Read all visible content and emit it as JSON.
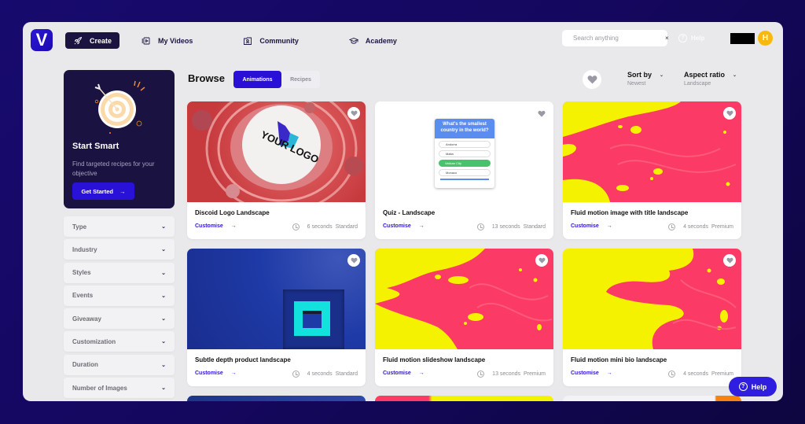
{
  "app": {
    "logo_letter": "V",
    "brand_color": "#2a0fd6"
  },
  "nav": {
    "items": [
      {
        "label": "Create",
        "icon": "rocket-icon",
        "active": true
      },
      {
        "label": "My Videos",
        "icon": "video-library-icon",
        "active": false
      },
      {
        "label": "Community",
        "icon": "community-icon",
        "active": false
      },
      {
        "label": "Academy",
        "icon": "graduation-cap-icon",
        "active": false
      }
    ],
    "search": {
      "placeholder": "Search anything",
      "value": "",
      "clear": "×"
    },
    "help_label": "Help",
    "help_glyph": "?",
    "avatar_initial": "H"
  },
  "promo": {
    "title": "Start Smart",
    "description": "Find targeted recipes for your objective",
    "cta_label": "Get Started",
    "cta_arrow": "→"
  },
  "filters": [
    {
      "label": "Type"
    },
    {
      "label": "Industry"
    },
    {
      "label": "Styles"
    },
    {
      "label": "Events"
    },
    {
      "label": "Giveaway"
    },
    {
      "label": "Customization"
    },
    {
      "label": "Duration"
    },
    {
      "label": "Number of Images"
    }
  ],
  "chevron": "⌄",
  "browse": {
    "title": "Browse",
    "tabs": [
      {
        "label": "Animations",
        "active": true
      },
      {
        "label": "Recipes",
        "active": false
      }
    ],
    "sort": {
      "label": "Sort by",
      "value": "Newest"
    },
    "aspect": {
      "label": "Aspect ratio",
      "value": "Landscape"
    }
  },
  "cards": [
    {
      "title": "Discoid Logo Landscape",
      "action": "Customise",
      "duration": "6 seconds",
      "tier": "Standard",
      "thumb_text": "YOUR LOGO"
    },
    {
      "title": "Quiz - Landscape",
      "action": "Customise",
      "duration": "13 seconds",
      "tier": "Standard",
      "quiz": {
        "question": "What's the smallest country in the world?",
        "options": [
          "Andorra",
          "Malta",
          "Vatican City",
          "Monaco"
        ],
        "correct_index": 2
      }
    },
    {
      "title": "Fluid motion image with title landscape",
      "action": "Customise",
      "duration": "4 seconds",
      "tier": "Premium"
    },
    {
      "title": "Subtle depth product landscape",
      "action": "Customise",
      "duration": "4 seconds",
      "tier": "Standard"
    },
    {
      "title": "Fluid motion slideshow landscape",
      "action": "Customise",
      "duration": "13 seconds",
      "tier": "Premium"
    },
    {
      "title": "Fluid motion mini bio landscape",
      "action": "Customise",
      "duration": "4 seconds",
      "tier": "Premium"
    }
  ],
  "help_float": {
    "label": "Help",
    "glyph": "?"
  }
}
